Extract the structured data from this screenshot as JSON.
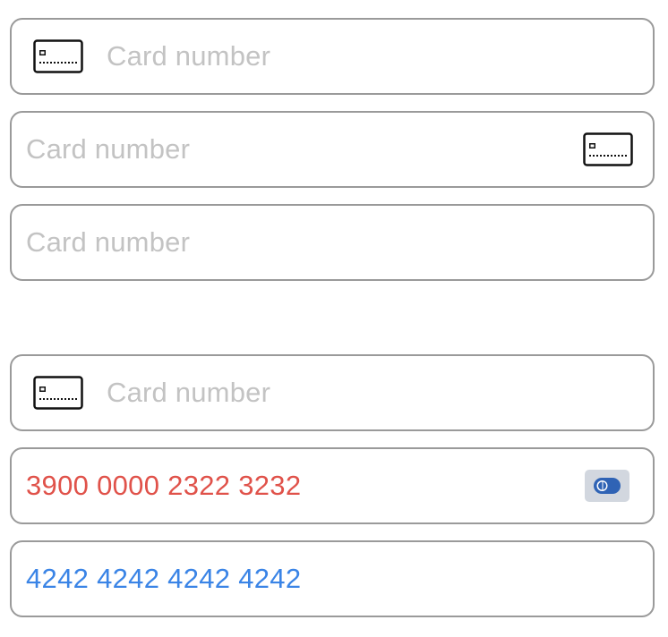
{
  "fields": [
    {
      "placeholder": "Card number",
      "value": "",
      "icon": "card-outline-icon",
      "icon_position": "leading"
    },
    {
      "placeholder": "Card number",
      "value": "",
      "icon": "card-outline-icon",
      "icon_position": "trailing"
    },
    {
      "placeholder": "Card number",
      "value": "",
      "icon": "",
      "icon_position": "none"
    },
    {
      "placeholder": "Card number",
      "value": "",
      "icon": "card-outline-icon",
      "icon_position": "leading"
    },
    {
      "placeholder": "",
      "value": "3900 0000 2322 3232",
      "icon": "diners-club-brand-icon",
      "icon_position": "trailing",
      "state": "invalid"
    },
    {
      "placeholder": "",
      "value": "4242 4242 4242 4242",
      "icon": "",
      "icon_position": "none",
      "state": "valid"
    }
  ],
  "colors": {
    "border": "#9a9a9a",
    "placeholder": "#c3c3c3",
    "error_text": "#e0524a",
    "valid_text": "#3a84e6",
    "badge_bg": "#d2d7df",
    "badge_logo": "#2f63b5"
  }
}
